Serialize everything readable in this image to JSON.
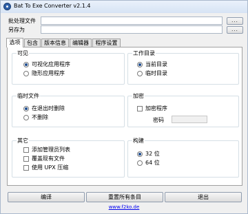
{
  "window": {
    "title": "Bat To Exe Converter v2.1.4"
  },
  "files": {
    "batch_label": "批处理文件",
    "batch_value": "",
    "saveas_label": "另存为",
    "saveas_value": "",
    "browse_label": "..."
  },
  "tabs": [
    {
      "label": "选项",
      "active": true
    },
    {
      "label": "包含",
      "active": false
    },
    {
      "label": "版本信息",
      "active": false
    },
    {
      "label": "编辑器",
      "active": false
    },
    {
      "label": "程序设置",
      "active": false
    }
  ],
  "groups": {
    "visibility": {
      "title": "可见",
      "options": [
        {
          "label": "可视化应用程序",
          "checked": true
        },
        {
          "label": "隐形应用程序",
          "checked": false
        }
      ]
    },
    "workdir": {
      "title": "工作目录",
      "options": [
        {
          "label": "当前目录",
          "checked": true
        },
        {
          "label": "临时目录",
          "checked": false
        }
      ]
    },
    "tempfiles": {
      "title": "临时文件",
      "options": [
        {
          "label": "在退出时删除",
          "checked": true
        },
        {
          "label": "不删除",
          "checked": false
        }
      ]
    },
    "encryption": {
      "title": "加密",
      "checkbox_label": "加密程序",
      "checkbox_checked": false,
      "password_label": "密码",
      "password_value": ""
    },
    "other": {
      "title": "其它",
      "checks": [
        {
          "label": "添加管理员列表",
          "checked": false
        },
        {
          "label": "覆盖现有文件",
          "checked": false
        },
        {
          "label": "使用 UPX 压缩",
          "checked": false
        }
      ]
    },
    "build": {
      "title": "构建",
      "options": [
        {
          "label": "32 位",
          "checked": true
        },
        {
          "label": "64 位",
          "checked": false
        }
      ]
    }
  },
  "buttons": {
    "compile": "编译",
    "reset": "重置所有条目",
    "exit": "退出"
  },
  "footer": {
    "link": "www.f2ko.de"
  },
  "colors": {
    "link": "#0000ee",
    "titlebar": "#d6e3f4",
    "radio_dot": "#1f4d8f"
  }
}
